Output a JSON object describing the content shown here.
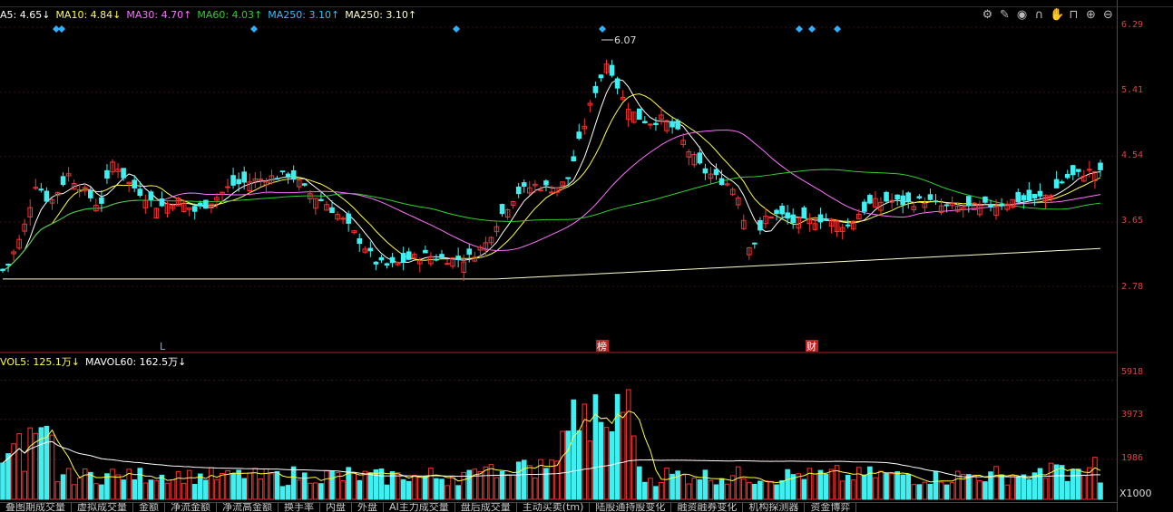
{
  "legend": [
    {
      "text": "A5: 4.65↓",
      "color": "#ffffff"
    },
    {
      "text": "MA10: 4.84↓",
      "color": "#ffff40"
    },
    {
      "text": "MA30: 4.70↑",
      "color": "#ff70ff"
    },
    {
      "text": "MA60: 4.03↑",
      "color": "#30d030"
    },
    {
      "text": "MA250: 3.10↑",
      "color": "#30c0ff"
    },
    {
      "text": "MA250: 3.10↑",
      "color": "#ffffcc"
    }
  ],
  "vol_legend": [
    {
      "text": "VOL5: 125.1万↓",
      "color": "#ffff40"
    },
    {
      "text": "MAVOL60: 162.5万↓",
      "color": "#ffffff"
    }
  ],
  "tools": [
    "gear-icon",
    "wrench-icon",
    "eye-icon",
    "magnet-icon",
    "hand-icon",
    "lock-icon",
    "zoom-in-icon",
    "zoom-out-icon"
  ],
  "yaxis_price": [
    "6.29",
    "5.41",
    "4.54",
    "3.65",
    "2.78"
  ],
  "yaxis_vol": [
    "5918",
    "3973",
    "1986"
  ],
  "vol_unit": "X1000",
  "annotations": {
    "high_label": "6.07",
    "marker_L": "L",
    "marker_bang": "榜",
    "marker_cai": "财"
  },
  "tabs": [
    "叠图期成交量",
    "虚拟成交量",
    "金额",
    "净流金额",
    "净流高金额",
    "换手率",
    "内盘",
    "外盘",
    "AI主力成交量",
    "盘后成交量",
    "主动买卖(tm)",
    "陆股通持股变化",
    "融资融券变化",
    "机构探测器",
    "资金博弈"
  ],
  "chart_data": {
    "type": "candlestick",
    "ylim": [
      2.35,
      6.55
    ],
    "ytick_labels": [
      6.29,
      5.41,
      4.54,
      3.65,
      2.78
    ],
    "volume_ytick_labels": [
      5918,
      3973,
      1986
    ],
    "volume_unit": "X1000",
    "annotated_high": 6.07,
    "colors": {
      "up": "#ff3030",
      "down": "#40f0f0",
      "ma5": "#ffffff",
      "ma10": "#ffff40",
      "ma30": "#ff70ff",
      "ma60": "#30d030",
      "ma250": "#ffffcc"
    }
  }
}
